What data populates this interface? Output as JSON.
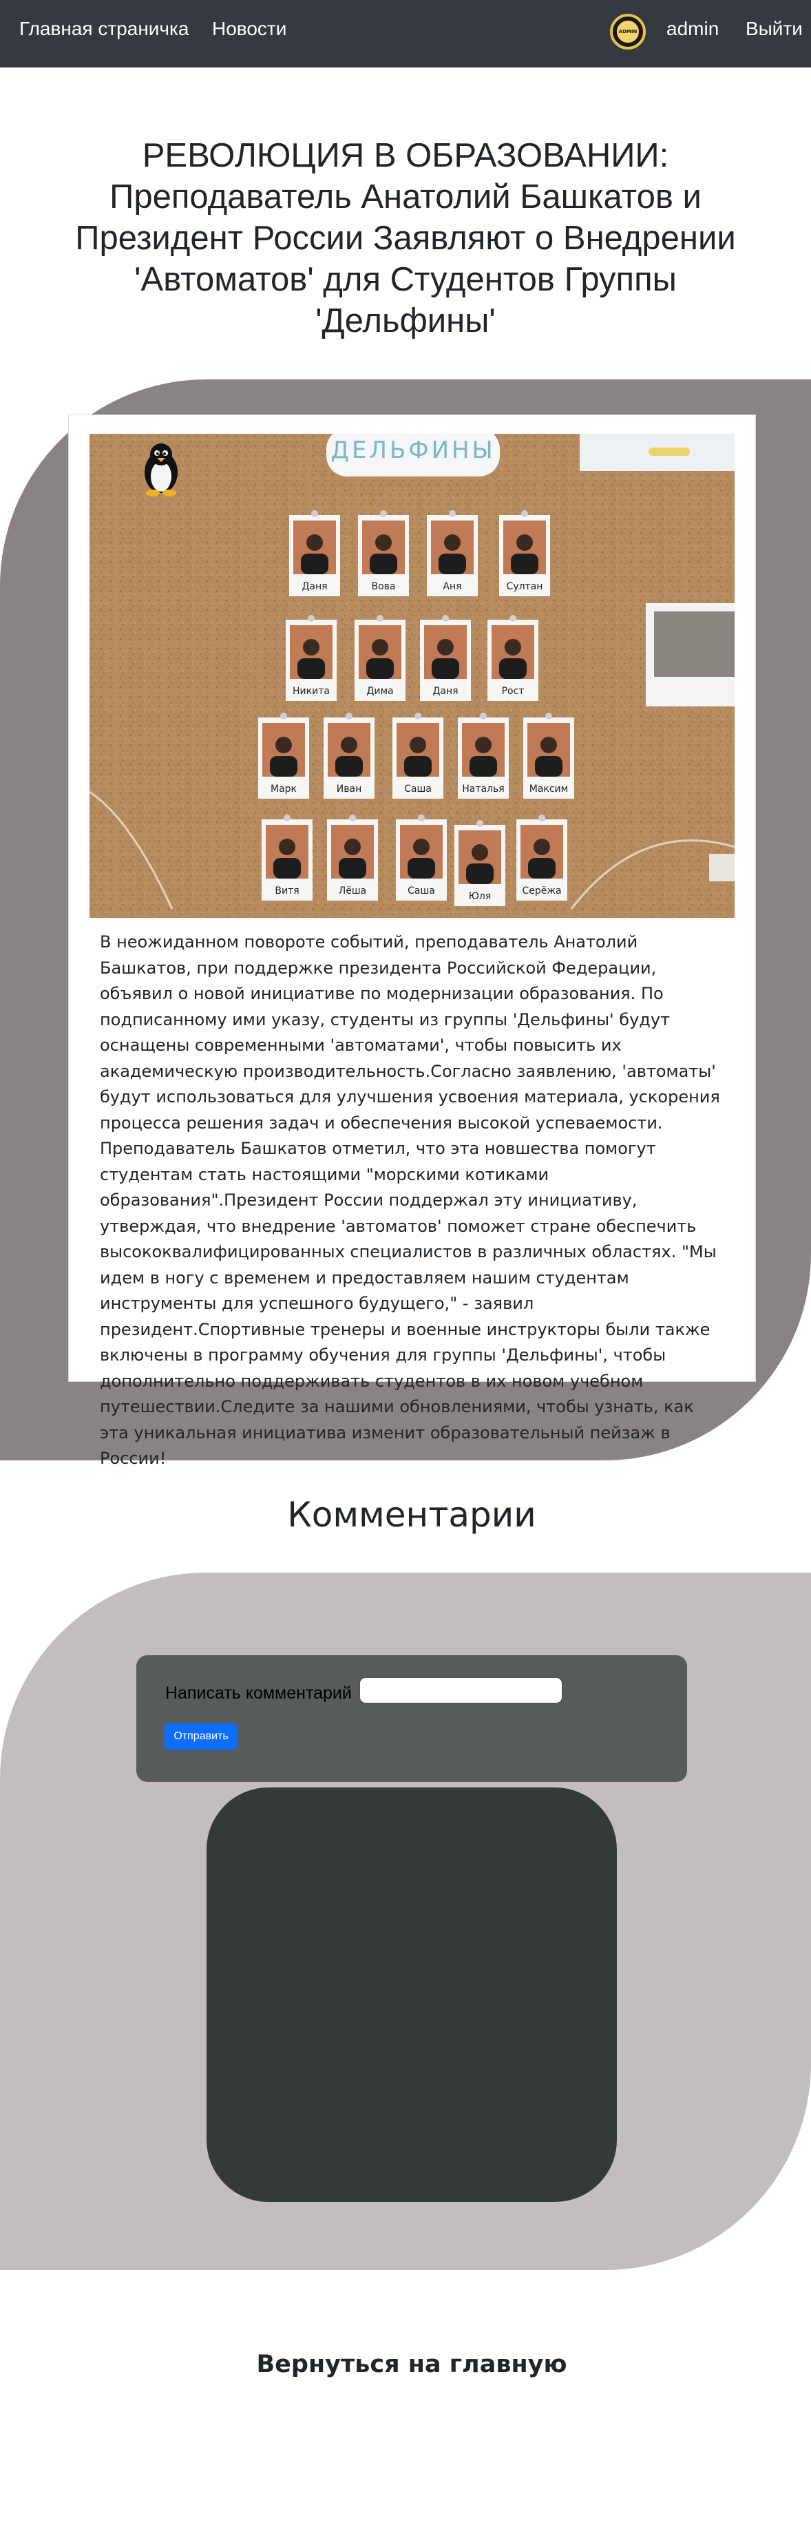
{
  "navbar": {
    "home": "Главная страничка",
    "news": "Новости",
    "avatar_text": "ADMIN",
    "user": "admin",
    "logout": "Выйти"
  },
  "article": {
    "title": "РЕВОЛЮЦИЯ В ОБРАЗОВАНИИ: Преподаватель Анатолий Башкатов и Президент России Заявляют о Внедрении 'Автоматов' для Студентов Группы 'Дельфины'",
    "photo": {
      "banner": "ДЕЛЬФИНЫ",
      "names": [
        "Даня",
        "Вова",
        "Аня",
        "Султан",
        "Никита",
        "Дима",
        "Даня",
        "Рост",
        "Марк",
        "Иван",
        "Саша",
        "Наталья",
        "Максим",
        "Витя",
        "Лёша",
        "Саша",
        "Юля",
        "Серёжа"
      ]
    },
    "body": "В неожиданном повороте событий, преподаватель Анатолий Башкатов, при поддержке президента Российской Федерации, объявил о новой инициативе по модернизации образования. По подписанному ими указу, студенты из группы 'Дельфины' будут оснащены современными 'автоматами', чтобы повысить их академическую производительность.Согласно заявлению, 'автоматы' будут использоваться для улучшения усвоения материала, ускорения процесса решения задач и обеспечения высокой успеваемости. Преподаватель Башкатов отметил, что эта новшества помогут студентам стать настоящими \"морскими котиками образования\".Президент России поддержал эту инициативу, утверждая, что внедрение 'автоматов' поможет стране обеспечить высококвалифицированных специалистов в различных областях. \"Мы идем в ногу с временем и предоставляем нашим студентам инструменты для успешного будущего,\" - заявил президент.Спортивные тренеры и военные инструкторы были также включены в программу обучения для группы 'Дельфины', чтобы дополнительно поддерживать студентов в их новом учебном путешествии.Следите за нашими обновлениями, чтобы узнать, как эта уникальная инициатива изменит образовательный пейзаж в России!"
  },
  "comments": {
    "heading": "Комментарии",
    "form_label": "Написать комментарий",
    "input_value": "",
    "submit": "Отправить"
  },
  "footer": {
    "back": "Вернуться на главную"
  },
  "colors": {
    "navbar": "#343a40",
    "article_bg": "#8a8383",
    "comments_bg": "#c3bebe",
    "form_bg": "#575b5c",
    "button": "#0d6efd",
    "comments_list": "#343a36"
  }
}
